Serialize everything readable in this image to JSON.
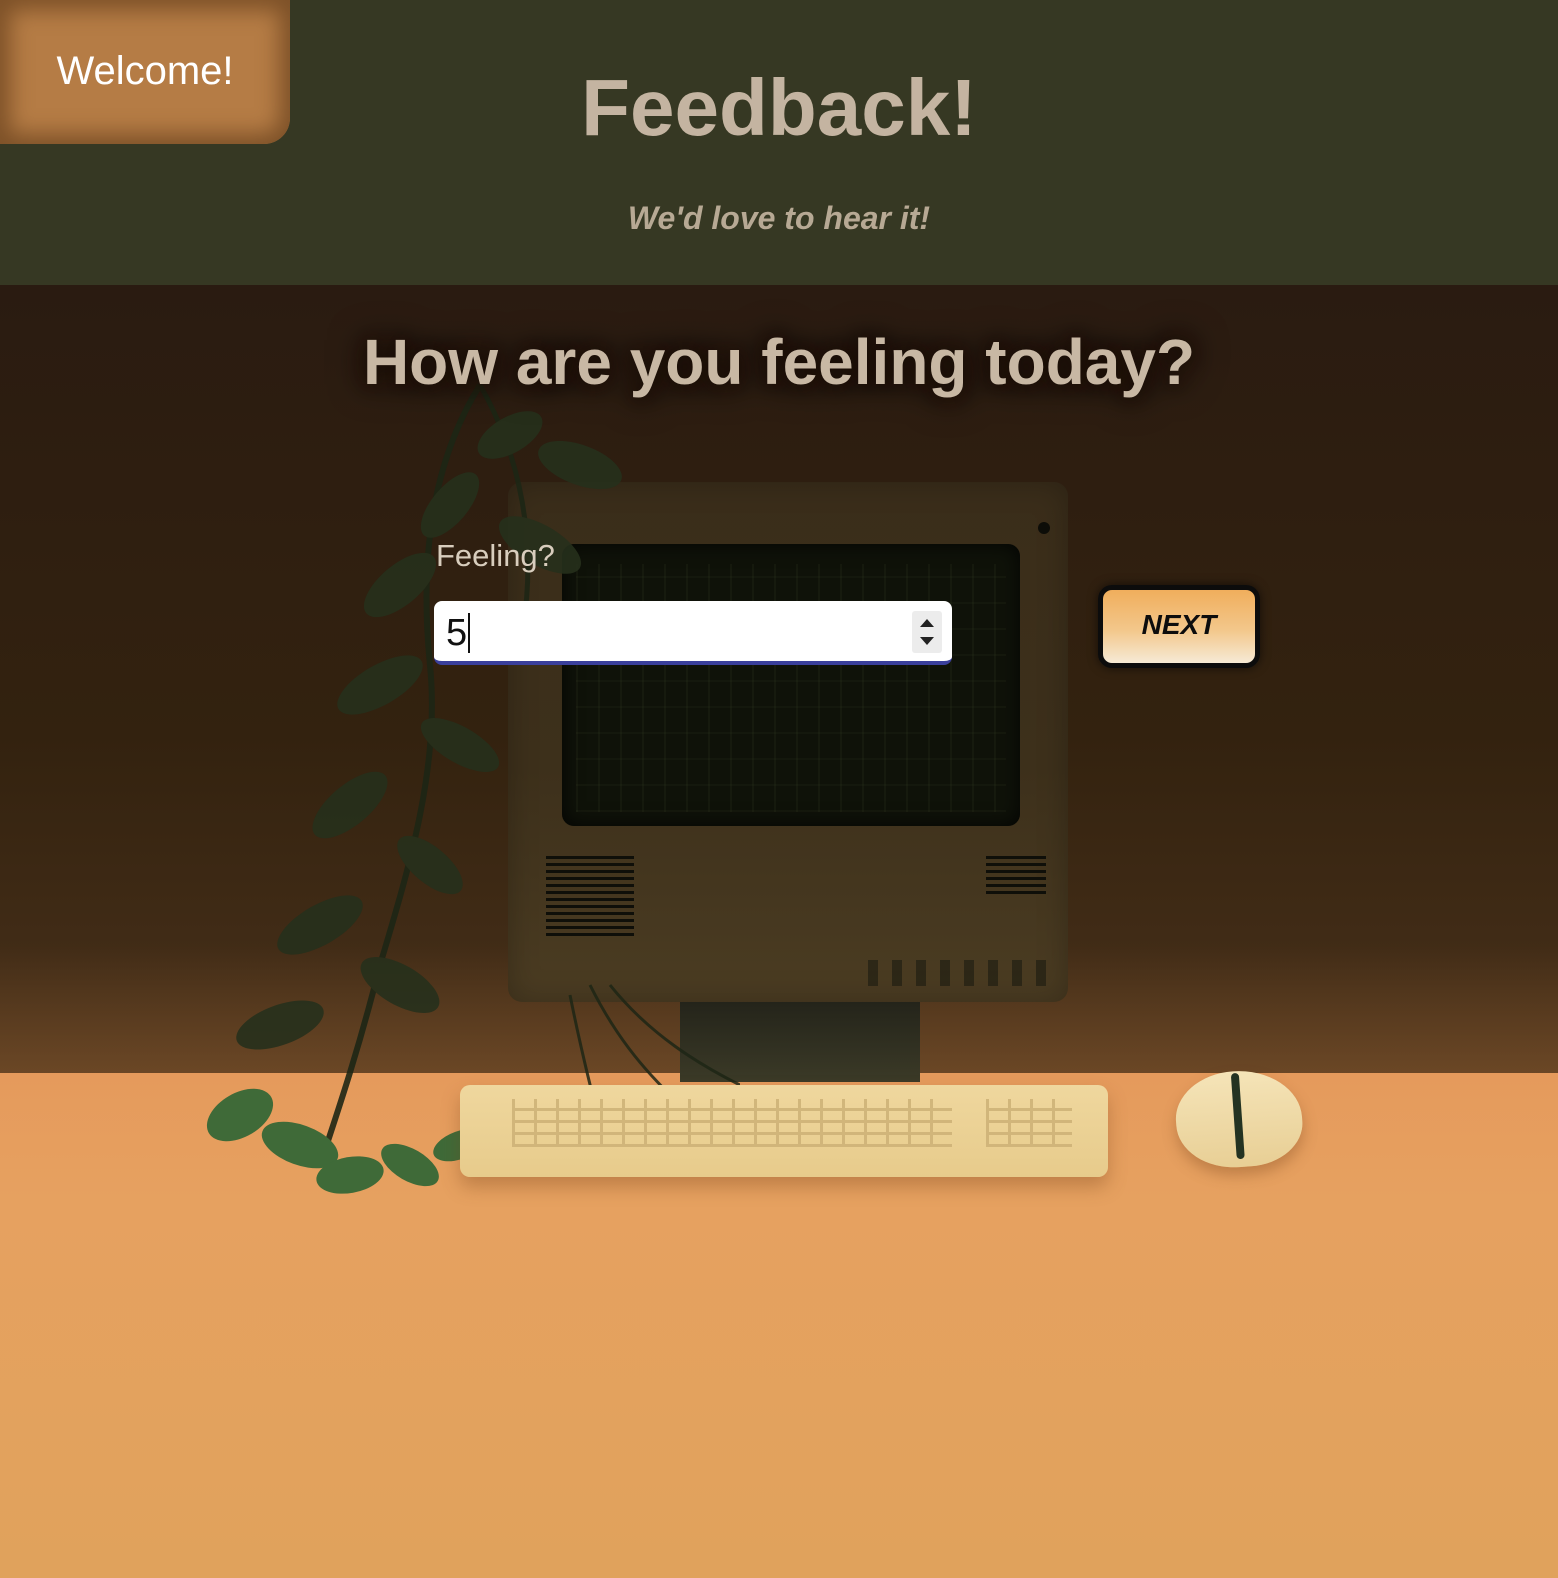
{
  "header": {
    "welcome_label": "Welcome!",
    "title": "Feedback!",
    "subtitle": "We'd love to hear it!"
  },
  "main": {
    "question": "How are you feeling today?",
    "feeling_field": {
      "label": "Feeling?",
      "value": "5",
      "type": "number"
    },
    "next_label": "NEXT"
  },
  "colors": {
    "header_bg": "#363823",
    "welcome_bg": "#b57c45",
    "title_text": "#c4b4a1",
    "next_button": "#f0ae5c",
    "input_focus_underline": "#3a3f9c"
  },
  "icons": {
    "stepper_up": "chevron-up-icon",
    "stepper_down": "chevron-down-icon"
  }
}
